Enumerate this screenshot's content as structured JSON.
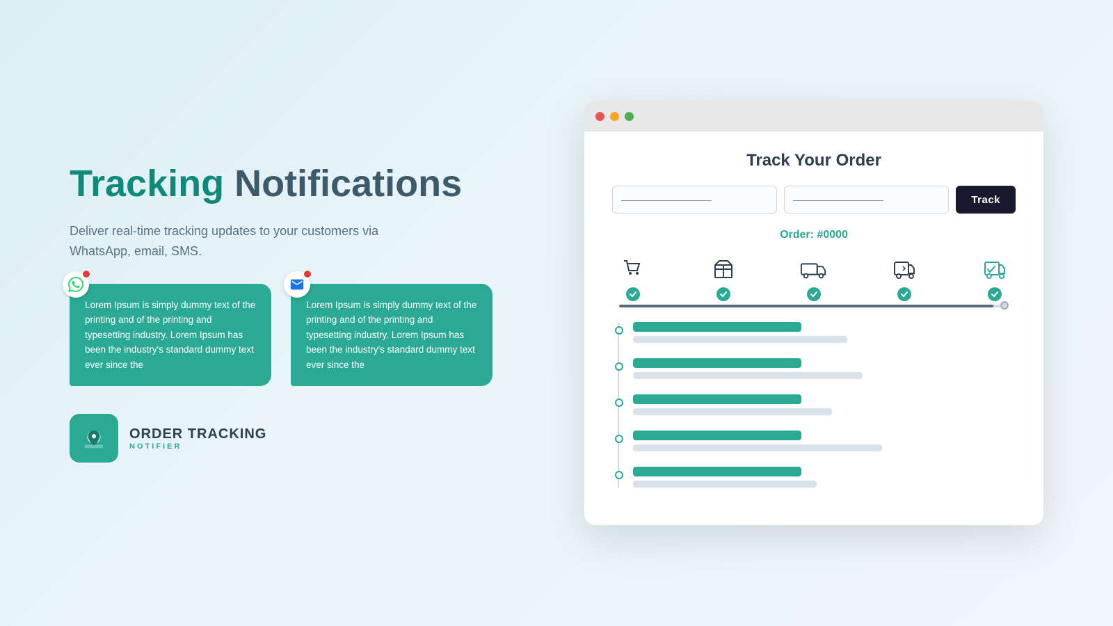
{
  "background": "#ddeef5",
  "left": {
    "headline_highlight": "Tracking",
    "headline_rest": " Notifications",
    "subtitle": "Deliver real-time tracking updates to your customers via WhatsApp, email, SMS.",
    "bubble1": {
      "text": "Lorem Ipsum is simply dummy text of the printing and of the printing and typesetting industry. Lorem Ipsum has been the industry's standard dummy text ever since the",
      "icon_type": "whatsapp"
    },
    "bubble2": {
      "text": "Lorem Ipsum is simply dummy text of the printing and of the printing and typesetting industry. Lorem Ipsum has been the industry's standard dummy text ever since the",
      "icon_type": "email"
    },
    "brand": {
      "name": "ORDER TRACKING",
      "sub": "NOTIFIER"
    }
  },
  "browser": {
    "title": "Track Your Order",
    "input1_placeholder": "——————————",
    "input2_placeholder": "——————————",
    "track_button": "Track",
    "order_number": "Order: #0000",
    "progress_percent": 96,
    "timeline_items": [
      {
        "primary_width": "44%",
        "secondary_width": "56%"
      },
      {
        "primary_width": "44%",
        "secondary_width": "60%"
      },
      {
        "primary_width": "44%",
        "secondary_width": "52%"
      },
      {
        "primary_width": "44%",
        "secondary_width": "65%"
      },
      {
        "primary_width": "44%",
        "secondary_width": "48%"
      }
    ]
  },
  "colors": {
    "teal": "#2aaa95",
    "dark": "#1a1a2e",
    "text_dark": "#2c3e50",
    "text_mid": "#5a7080",
    "gray_bar": "#d0d8e0"
  }
}
